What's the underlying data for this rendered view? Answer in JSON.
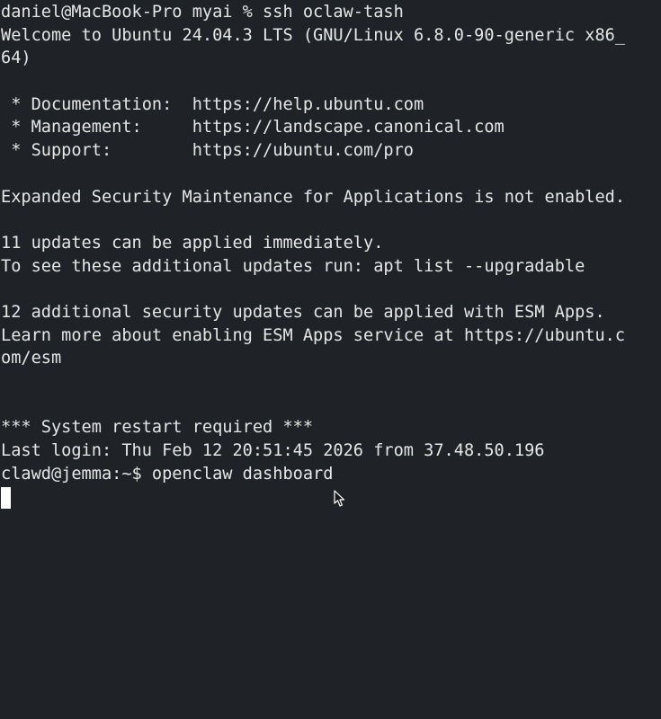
{
  "terminal": {
    "lines": [
      "daniel@MacBook-Pro myai % ssh oclaw-tash",
      "Welcome to Ubuntu 24.04.3 LTS (GNU/Linux 6.8.0-90-generic x86_",
      "64)",
      "",
      " * Documentation:  https://help.ubuntu.com",
      " * Management:     https://landscape.canonical.com",
      " * Support:        https://ubuntu.com/pro",
      "",
      "Expanded Security Maintenance for Applications is not enabled.",
      "",
      "11 updates can be applied immediately.",
      "To see these additional updates run: apt list --upgradable",
      "",
      "12 additional security updates can be applied with ESM Apps.",
      "Learn more about enabling ESM Apps service at https://ubuntu.c",
      "om/esm",
      "",
      "",
      "*** System restart required ***",
      "Last login: Thu Feb 12 20:51:45 2026 from 37.48.50.196",
      "clawd@jemma:~$ openclaw dashboard"
    ]
  },
  "colors": {
    "background": "#1f2227",
    "foreground": "#e6e6e6",
    "cursor": "#ffffff"
  },
  "icons": {
    "pointer": "mouse-pointer-icon"
  }
}
